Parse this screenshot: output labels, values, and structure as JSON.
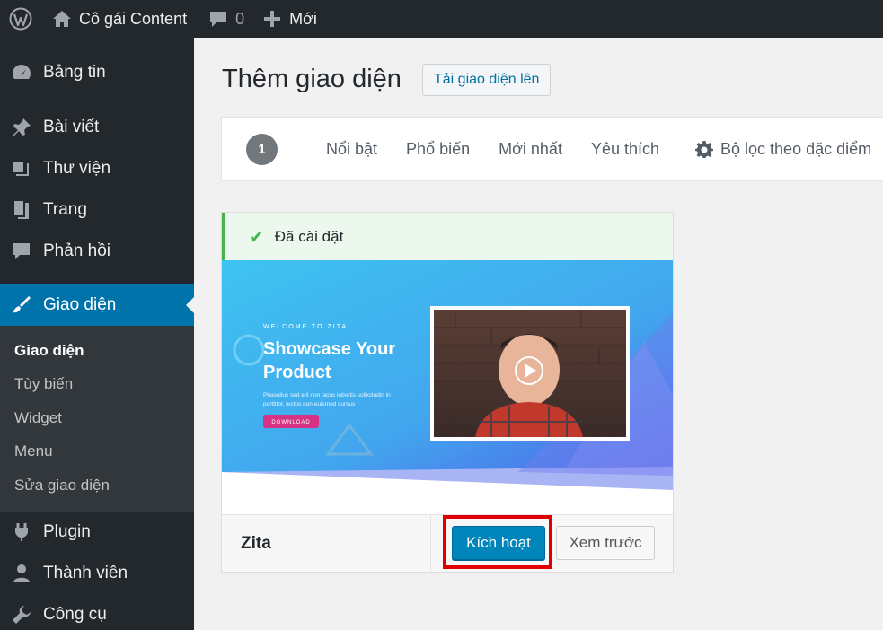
{
  "adminbar": {
    "wp_logo_icon": "wordpress-logo-icon",
    "site_name": "Cô gái Content",
    "comments_count": "0",
    "new_label": "Mới"
  },
  "sidebar": {
    "items": [
      {
        "label": "Bảng tin",
        "icon": "dashboard-icon"
      },
      {
        "label": "Bài viết",
        "icon": "pin-icon"
      },
      {
        "label": "Thư viện",
        "icon": "media-icon"
      },
      {
        "label": "Trang",
        "icon": "page-icon"
      },
      {
        "label": "Phản hồi",
        "icon": "comment-icon"
      },
      {
        "label": "Giao diện",
        "icon": "brush-icon"
      },
      {
        "label": "Plugin",
        "icon": "plugin-icon"
      },
      {
        "label": "Thành viên",
        "icon": "user-icon"
      },
      {
        "label": "Công cụ",
        "icon": "wrench-icon"
      }
    ],
    "submenu": [
      "Giao diện",
      "Tùy biến",
      "Widget",
      "Menu",
      "Sửa giao diện"
    ],
    "accent": "#0073aa"
  },
  "main": {
    "title": "Thêm giao diện",
    "upload_label": "Tải giao diện lên",
    "filter": {
      "count": "1",
      "links": [
        "Nổi bật",
        "Phổ biến",
        "Mới nhất",
        "Yêu thích"
      ],
      "feature_filter": "Bộ lọc theo đặc điểm"
    },
    "theme": {
      "installed_notice": "Đã cài đặt",
      "name": "Zita",
      "activate_label": "Kích hoạt",
      "preview_label": "Xem trước",
      "screenshot": {
        "eyebrow": "WELCOME TO ZITA",
        "headline_line1": "Showcase Your",
        "headline_line2": "Product",
        "body_line1": "Phasellus sed elit non lacus lobortis sollicitudin in",
        "body_line2": "porttitor, lectus non euismod cursus",
        "button": "DOWNLOAD"
      }
    }
  }
}
